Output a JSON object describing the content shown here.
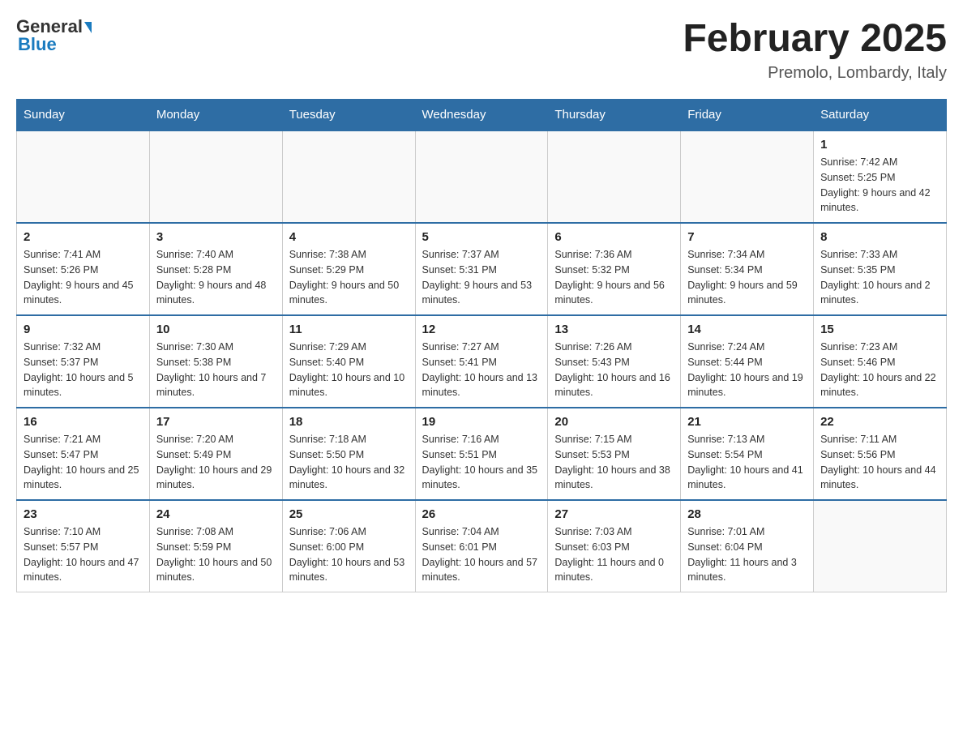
{
  "header": {
    "title": "February 2025",
    "subtitle": "Premolo, Lombardy, Italy",
    "logo_general": "General",
    "logo_blue": "Blue"
  },
  "weekdays": [
    "Sunday",
    "Monday",
    "Tuesday",
    "Wednesday",
    "Thursday",
    "Friday",
    "Saturday"
  ],
  "weeks": [
    [
      {
        "day": "",
        "info": ""
      },
      {
        "day": "",
        "info": ""
      },
      {
        "day": "",
        "info": ""
      },
      {
        "day": "",
        "info": ""
      },
      {
        "day": "",
        "info": ""
      },
      {
        "day": "",
        "info": ""
      },
      {
        "day": "1",
        "info": "Sunrise: 7:42 AM\nSunset: 5:25 PM\nDaylight: 9 hours and 42 minutes."
      }
    ],
    [
      {
        "day": "2",
        "info": "Sunrise: 7:41 AM\nSunset: 5:26 PM\nDaylight: 9 hours and 45 minutes."
      },
      {
        "day": "3",
        "info": "Sunrise: 7:40 AM\nSunset: 5:28 PM\nDaylight: 9 hours and 48 minutes."
      },
      {
        "day": "4",
        "info": "Sunrise: 7:38 AM\nSunset: 5:29 PM\nDaylight: 9 hours and 50 minutes."
      },
      {
        "day": "5",
        "info": "Sunrise: 7:37 AM\nSunset: 5:31 PM\nDaylight: 9 hours and 53 minutes."
      },
      {
        "day": "6",
        "info": "Sunrise: 7:36 AM\nSunset: 5:32 PM\nDaylight: 9 hours and 56 minutes."
      },
      {
        "day": "7",
        "info": "Sunrise: 7:34 AM\nSunset: 5:34 PM\nDaylight: 9 hours and 59 minutes."
      },
      {
        "day": "8",
        "info": "Sunrise: 7:33 AM\nSunset: 5:35 PM\nDaylight: 10 hours and 2 minutes."
      }
    ],
    [
      {
        "day": "9",
        "info": "Sunrise: 7:32 AM\nSunset: 5:37 PM\nDaylight: 10 hours and 5 minutes."
      },
      {
        "day": "10",
        "info": "Sunrise: 7:30 AM\nSunset: 5:38 PM\nDaylight: 10 hours and 7 minutes."
      },
      {
        "day": "11",
        "info": "Sunrise: 7:29 AM\nSunset: 5:40 PM\nDaylight: 10 hours and 10 minutes."
      },
      {
        "day": "12",
        "info": "Sunrise: 7:27 AM\nSunset: 5:41 PM\nDaylight: 10 hours and 13 minutes."
      },
      {
        "day": "13",
        "info": "Sunrise: 7:26 AM\nSunset: 5:43 PM\nDaylight: 10 hours and 16 minutes."
      },
      {
        "day": "14",
        "info": "Sunrise: 7:24 AM\nSunset: 5:44 PM\nDaylight: 10 hours and 19 minutes."
      },
      {
        "day": "15",
        "info": "Sunrise: 7:23 AM\nSunset: 5:46 PM\nDaylight: 10 hours and 22 minutes."
      }
    ],
    [
      {
        "day": "16",
        "info": "Sunrise: 7:21 AM\nSunset: 5:47 PM\nDaylight: 10 hours and 25 minutes."
      },
      {
        "day": "17",
        "info": "Sunrise: 7:20 AM\nSunset: 5:49 PM\nDaylight: 10 hours and 29 minutes."
      },
      {
        "day": "18",
        "info": "Sunrise: 7:18 AM\nSunset: 5:50 PM\nDaylight: 10 hours and 32 minutes."
      },
      {
        "day": "19",
        "info": "Sunrise: 7:16 AM\nSunset: 5:51 PM\nDaylight: 10 hours and 35 minutes."
      },
      {
        "day": "20",
        "info": "Sunrise: 7:15 AM\nSunset: 5:53 PM\nDaylight: 10 hours and 38 minutes."
      },
      {
        "day": "21",
        "info": "Sunrise: 7:13 AM\nSunset: 5:54 PM\nDaylight: 10 hours and 41 minutes."
      },
      {
        "day": "22",
        "info": "Sunrise: 7:11 AM\nSunset: 5:56 PM\nDaylight: 10 hours and 44 minutes."
      }
    ],
    [
      {
        "day": "23",
        "info": "Sunrise: 7:10 AM\nSunset: 5:57 PM\nDaylight: 10 hours and 47 minutes."
      },
      {
        "day": "24",
        "info": "Sunrise: 7:08 AM\nSunset: 5:59 PM\nDaylight: 10 hours and 50 minutes."
      },
      {
        "day": "25",
        "info": "Sunrise: 7:06 AM\nSunset: 6:00 PM\nDaylight: 10 hours and 53 minutes."
      },
      {
        "day": "26",
        "info": "Sunrise: 7:04 AM\nSunset: 6:01 PM\nDaylight: 10 hours and 57 minutes."
      },
      {
        "day": "27",
        "info": "Sunrise: 7:03 AM\nSunset: 6:03 PM\nDaylight: 11 hours and 0 minutes."
      },
      {
        "day": "28",
        "info": "Sunrise: 7:01 AM\nSunset: 6:04 PM\nDaylight: 11 hours and 3 minutes."
      },
      {
        "day": "",
        "info": ""
      }
    ]
  ]
}
